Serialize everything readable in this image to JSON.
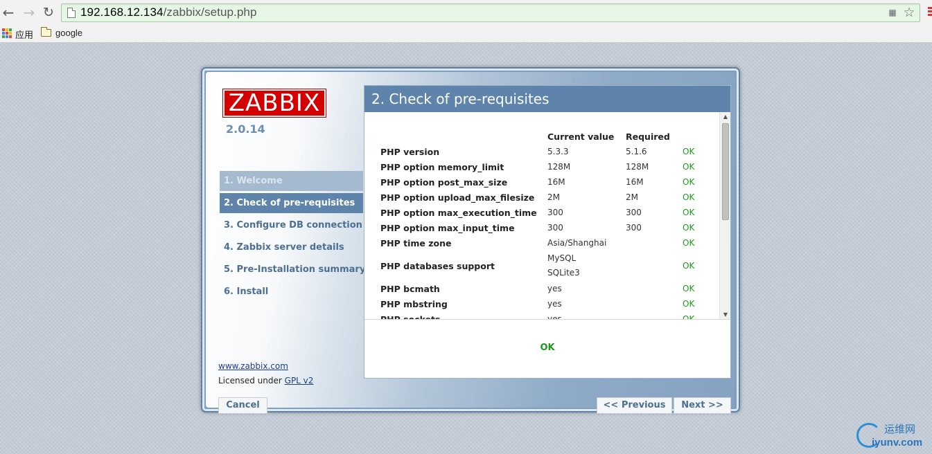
{
  "browser": {
    "url_host": "192.168.12.134",
    "url_path": "/zabbix/setup.php",
    "bookmarks": [
      {
        "label": "应用"
      },
      {
        "label": "google"
      }
    ]
  },
  "setup": {
    "logo_text": "ZABBIX",
    "version": "2.0.14",
    "steps": [
      {
        "label": "1. Welcome",
        "state": "done"
      },
      {
        "label": "2. Check of pre-requisites",
        "state": "active"
      },
      {
        "label": "3. Configure DB connection",
        "state": "pending"
      },
      {
        "label": "4. Zabbix server details",
        "state": "pending"
      },
      {
        "label": "5. Pre-Installation summary",
        "state": "pending"
      },
      {
        "label": "6. Install",
        "state": "pending"
      }
    ],
    "footer": {
      "site_link": "www.zabbix.com",
      "license_prefix": "Licensed under ",
      "license_link": "GPL v2"
    },
    "panel_title": "2. Check of pre-requisites",
    "table": {
      "headers": [
        "",
        "Current value",
        "Required",
        ""
      ],
      "rows": [
        {
          "name": "PHP version",
          "current": [
            "5.3.3"
          ],
          "required": "5.1.6",
          "result": "OK"
        },
        {
          "name": "PHP option memory_limit",
          "current": [
            "128M"
          ],
          "required": "128M",
          "result": "OK"
        },
        {
          "name": "PHP option post_max_size",
          "current": [
            "16M"
          ],
          "required": "16M",
          "result": "OK"
        },
        {
          "name": "PHP option upload_max_filesize",
          "current": [
            "2M"
          ],
          "required": "2M",
          "result": "OK"
        },
        {
          "name": "PHP option max_execution_time",
          "current": [
            "300"
          ],
          "required": "300",
          "result": "OK"
        },
        {
          "name": "PHP option max_input_time",
          "current": [
            "300"
          ],
          "required": "300",
          "result": "OK"
        },
        {
          "name": "PHP time zone",
          "current": [
            "Asia/Shanghai"
          ],
          "required": "",
          "result": "OK"
        },
        {
          "name": "PHP databases support",
          "current": [
            "MySQL",
            "SQLite3"
          ],
          "required": "",
          "result": "OK"
        },
        {
          "name": "PHP bcmath",
          "current": [
            "yes"
          ],
          "required": "",
          "result": "OK"
        },
        {
          "name": "PHP mbstring",
          "current": [
            "yes"
          ],
          "required": "",
          "result": "OK"
        },
        {
          "name": "PHP sockets",
          "current": [
            "yes"
          ],
          "required": "",
          "result": "OK"
        }
      ]
    },
    "overall_status": "OK",
    "buttons": {
      "cancel": "Cancel",
      "previous": "<< Previous",
      "next": "Next >>"
    }
  },
  "watermark": {
    "cn": "运维网",
    "en": "iyunv.com"
  },
  "colors": {
    "header_blue": "#5f84ab",
    "ok_green": "#1a9a1a",
    "logo_red": "#d40000"
  }
}
